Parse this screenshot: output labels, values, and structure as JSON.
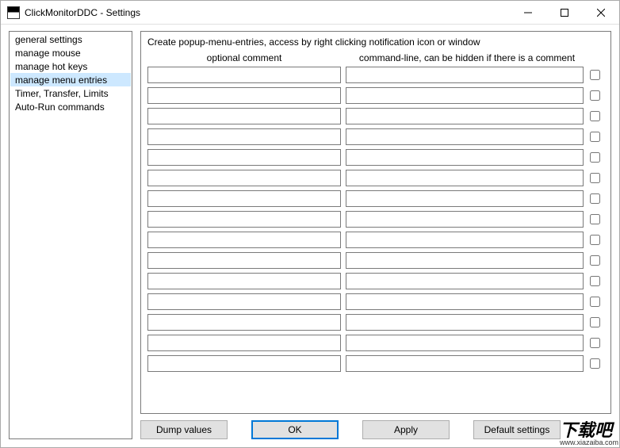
{
  "window": {
    "title": "ClickMonitorDDC - Settings"
  },
  "sidebar": {
    "items": [
      {
        "label": "general settings",
        "selected": false
      },
      {
        "label": "manage mouse",
        "selected": false
      },
      {
        "label": "manage hot keys",
        "selected": false
      },
      {
        "label": "manage menu entries",
        "selected": true
      },
      {
        "label": "Timer, Transfer, Limits",
        "selected": false
      },
      {
        "label": "Auto-Run commands",
        "selected": false
      }
    ]
  },
  "panel": {
    "heading": "Create popup-menu-entries, access by right clicking notification icon or window",
    "col1": "optional comment",
    "col2": "command-line, can be hidden if there is a comment",
    "rows": [
      {
        "comment": "",
        "cmdline": "",
        "checked": false
      },
      {
        "comment": "",
        "cmdline": "",
        "checked": false
      },
      {
        "comment": "",
        "cmdline": "",
        "checked": false
      },
      {
        "comment": "",
        "cmdline": "",
        "checked": false
      },
      {
        "comment": "",
        "cmdline": "",
        "checked": false
      },
      {
        "comment": "",
        "cmdline": "",
        "checked": false
      },
      {
        "comment": "",
        "cmdline": "",
        "checked": false
      },
      {
        "comment": "",
        "cmdline": "",
        "checked": false
      },
      {
        "comment": "",
        "cmdline": "",
        "checked": false
      },
      {
        "comment": "",
        "cmdline": "",
        "checked": false
      },
      {
        "comment": "",
        "cmdline": "",
        "checked": false
      },
      {
        "comment": "",
        "cmdline": "",
        "checked": false
      },
      {
        "comment": "",
        "cmdline": "",
        "checked": false
      },
      {
        "comment": "",
        "cmdline": "",
        "checked": false
      },
      {
        "comment": "",
        "cmdline": "",
        "checked": false
      }
    ]
  },
  "buttons": {
    "dump": "Dump values",
    "ok": "OK",
    "apply": "Apply",
    "defaults": "Default settings"
  },
  "watermark": {
    "main": "下载吧",
    "sub": "www.xiazaiba.com"
  }
}
